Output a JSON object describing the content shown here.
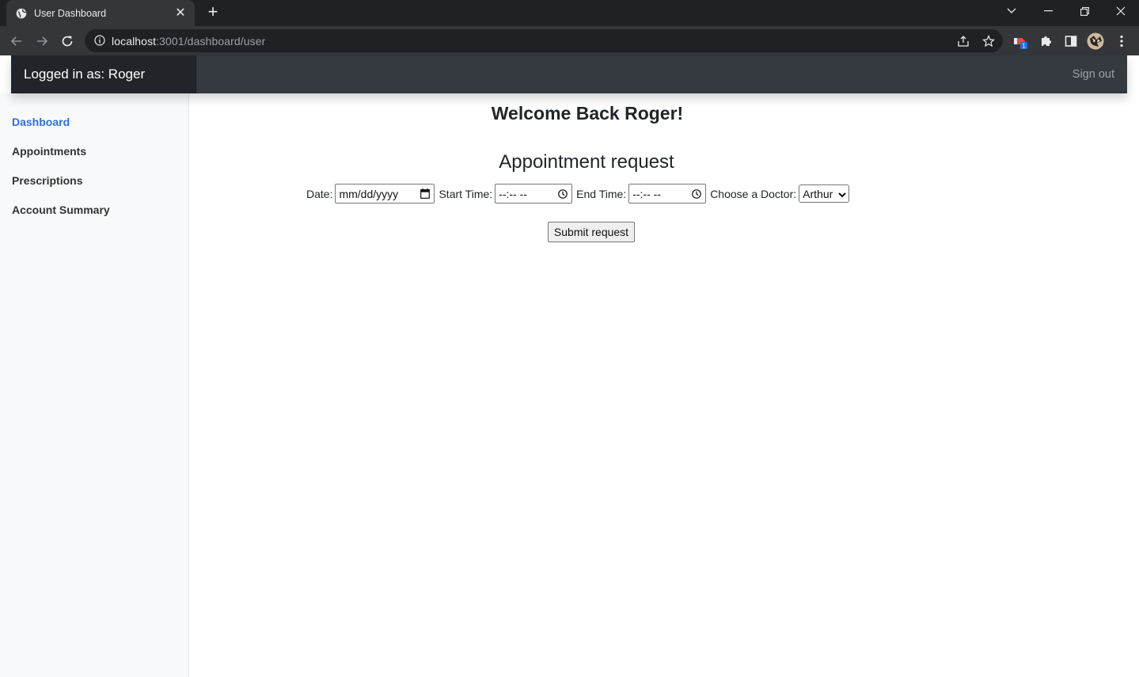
{
  "browser": {
    "tab_title": "User Dashboard",
    "url_host": "localhost",
    "url_path": ":3001/dashboard/user",
    "extension_badge": "1"
  },
  "navbar": {
    "brand": "Logged in as: Roger",
    "signout": "Sign out"
  },
  "sidebar": {
    "items": [
      {
        "label": "Dashboard",
        "active": true
      },
      {
        "label": "Appointments",
        "active": false
      },
      {
        "label": "Prescriptions",
        "active": false
      },
      {
        "label": "Account Summary",
        "active": false
      }
    ]
  },
  "main": {
    "welcome_prefix": "Welcome Back ",
    "welcome_name": "Roger!",
    "request_title": "Appointment request",
    "date_label": "Date:",
    "date_value": "mm/dd/yyyy",
    "start_label": "Start Time:",
    "start_value": "--:-- --",
    "end_label": "End Time:",
    "end_value": "--:-- --",
    "doctor_label": "Choose a Doctor:",
    "doctor_value": "Arthur",
    "submit_label": "Submit request"
  },
  "colors": {
    "navbar": "#343a40",
    "brand": "#212529",
    "sidebar": "#f8f9fa",
    "active_link": "#2f6fdb"
  }
}
